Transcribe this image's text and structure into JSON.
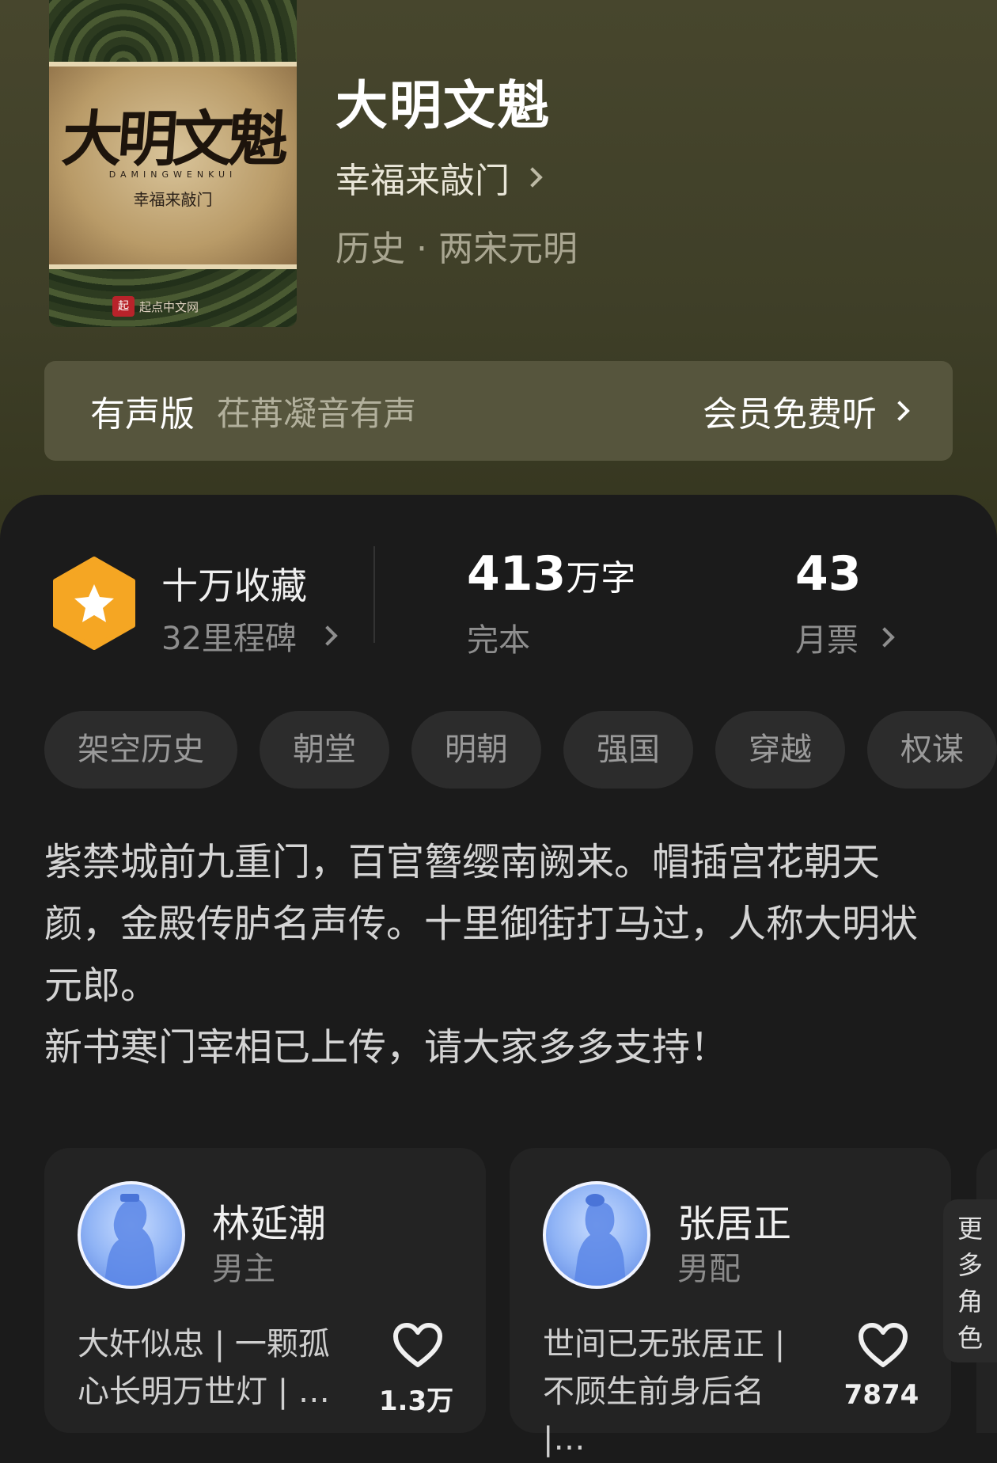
{
  "book": {
    "cover_title": "大明文魁",
    "cover_pinyin": "DAMINGWENKUI",
    "cover_author": "幸福来敲门",
    "cover_publisher": "起点中文网",
    "title": "大明文魁",
    "author": "幸福来敲门",
    "genre": "历史 · 两宋元明"
  },
  "audio": {
    "label": "有声版",
    "narrator": "茌苒凝音有声",
    "action": "会员免费听"
  },
  "stats": {
    "collection": "十万收藏",
    "milestones": "32里程碑",
    "words_value": "413",
    "words_unit": "万字",
    "status": "完本",
    "monthly_votes": "43",
    "monthly_votes_label": "月票"
  },
  "tags": [
    "架空历史",
    "朝堂",
    "明朝",
    "强国",
    "穿越",
    "权谋"
  ],
  "description": {
    "line1": "紫禁城前九重门，百官簪缨南阙来。帽插宫花朝天颜，金殿传胪名声传。十里御街打马过，人称大明状元郎。",
    "line2": "新书寒门宰相已上传，请大家多多支持！"
  },
  "roles": [
    {
      "name": "林延潮",
      "type": "男主",
      "tags": "大奸似忠 | 一颗孤心长明万世灯 | …",
      "likes": "1.3万"
    },
    {
      "name": "张居正",
      "type": "男配",
      "tags": "世间已无张居正 | 不顾生前身后名 |…",
      "likes": "7874"
    }
  ],
  "more_roles": "更多角色",
  "colors": {
    "header_bg": "#47462d",
    "panel_bg": "#1b1b1b",
    "badge": "#f5a623",
    "avatar_blue": "#8fb3f5"
  }
}
